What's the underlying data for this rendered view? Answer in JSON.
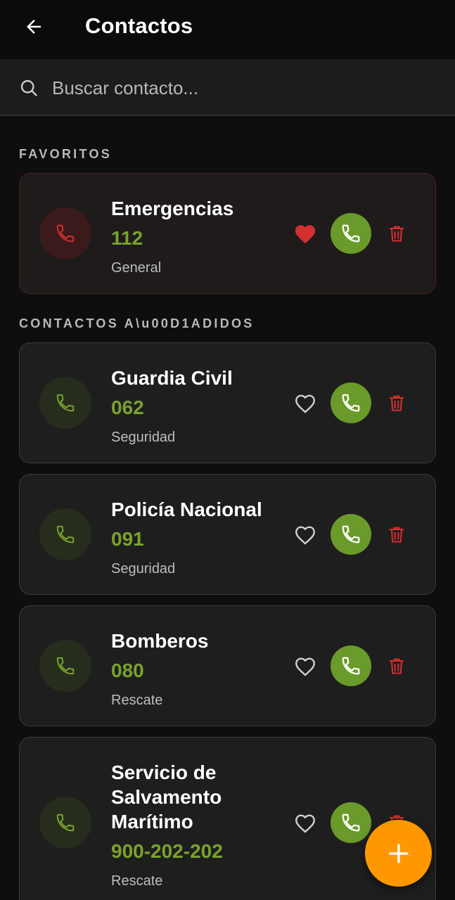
{
  "header": {
    "title": "Contactos"
  },
  "search": {
    "placeholder": "Buscar contacto..."
  },
  "sections": {
    "favorites": "FAVORITOS",
    "added": "CONTACTOS A\\u00D1ADIDOS"
  },
  "favorites": [
    {
      "name": "Emergencias",
      "number": "112",
      "category": "General",
      "favorite": true
    }
  ],
  "contacts": [
    {
      "name": "Guardia Civil",
      "number": "062",
      "category": "Seguridad",
      "favorite": false
    },
    {
      "name": "Policía Nacional",
      "number": "091",
      "category": "Seguridad",
      "favorite": false
    },
    {
      "name": "Bomberos",
      "number": "080",
      "category": "Rescate",
      "favorite": false
    },
    {
      "name": "Servicio de Salvamento Marítimo",
      "number": "900-202-202",
      "category": "Rescate",
      "favorite": false
    }
  ],
  "colors": {
    "accent_green": "#7aa22c",
    "call_button": "#6a9a2a",
    "delete_red": "#d32f2f",
    "favorite_red": "#d32f2f",
    "fab_orange": "#ff9800"
  },
  "icons": {
    "back": "arrow-left-icon",
    "search": "search-icon",
    "phone": "phone-icon",
    "heart": "heart-icon",
    "trash": "trash-icon",
    "add": "plus-icon"
  }
}
